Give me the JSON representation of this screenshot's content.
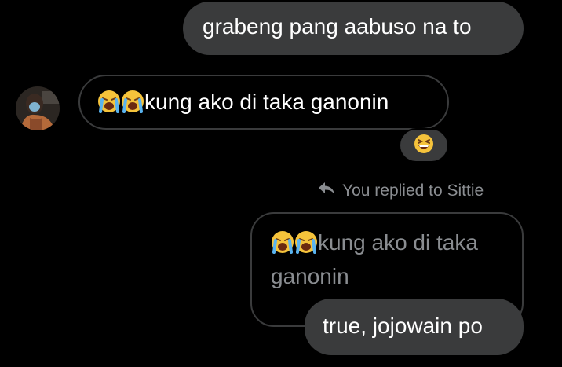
{
  "messages": {
    "outgoing_1": "grabeng pang aabuso na to",
    "incoming_1": {
      "text": "kung ako di taka ganonin",
      "emojis": [
        "loudly-crying-face",
        "loudly-crying-face"
      ],
      "reaction": "grinning-squinting-face"
    },
    "reply": {
      "label": "You replied to Sittie",
      "quoted_text": "kung ako di taka ganonin",
      "quoted_emojis": [
        "loudly-crying-face",
        "loudly-crying-face"
      ],
      "text": "true, jojowain po"
    }
  },
  "icons": {
    "reply": "reply-arrow-icon"
  },
  "colors": {
    "background": "#000000",
    "bubble": "#3a3b3c",
    "muted_text": "#8a8d91"
  }
}
